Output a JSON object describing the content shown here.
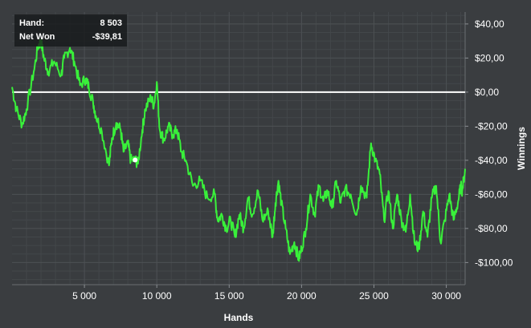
{
  "tooltip": {
    "hand_label": "Hand:",
    "hand_value": "8 503",
    "net_label": "Net Won",
    "net_value": "-$39,81"
  },
  "colors": {
    "background": "#3a3d40",
    "grid": "#4c5053",
    "line": "#39f03a",
    "zero_line": "#ffffff"
  },
  "chart_data": {
    "type": "line",
    "xlabel": "Hands",
    "ylabel": "Winnings",
    "xlim": [
      0,
      31300
    ],
    "ylim": [
      -113,
      47
    ],
    "x_ticks": [
      5000,
      10000,
      15000,
      20000,
      25000,
      30000
    ],
    "x_tick_labels": [
      "5 000",
      "10 000",
      "15 000",
      "20 000",
      "25 000",
      "30 000"
    ],
    "y_ticks": [
      40,
      20,
      0,
      -20,
      -40,
      -60,
      -80,
      -100
    ],
    "y_tick_labels": [
      "$40,00",
      "$20,00",
      "$0,00",
      "-$20,00",
      "-$40,00",
      "-$60,00",
      "-$80,00",
      "-$100,00"
    ],
    "grid": true,
    "zero_line": true,
    "highlight_point": {
      "x": 8503,
      "y": -39.81
    },
    "series": [
      {
        "x": [
          0,
          300,
          700,
          1000,
          1500,
          1800,
          2000,
          2200,
          2500,
          2900,
          3400,
          3600,
          4000,
          4300,
          4700,
          5100,
          5300,
          5600,
          5800,
          6200,
          6700,
          6900,
          7200,
          7500,
          7700,
          8000,
          8200,
          8500,
          8700,
          9000,
          9200,
          9600,
          9800,
          10000,
          10200,
          10500,
          10800,
          11100,
          11400,
          11700,
          12000,
          12500,
          13000,
          13500,
          14000,
          14200,
          14500,
          14800,
          15100,
          15400,
          15700,
          16000,
          16300,
          16600,
          17000,
          17300,
          17700,
          18000,
          18200,
          18400,
          18600,
          18900,
          19200,
          19500,
          19800,
          20000,
          20300,
          20600,
          20900,
          21200,
          21500,
          21800,
          22100,
          22400,
          22700,
          23000,
          23400,
          23800,
          24100,
          24500,
          24800,
          25100,
          25400,
          25700,
          26000,
          26300,
          26600,
          26900,
          27200,
          27500,
          27800,
          28100,
          28400,
          28700,
          29000,
          29300,
          29600,
          29900,
          30200,
          30500,
          30800,
          31000,
          31100,
          31300
        ],
        "y": [
          3,
          -10,
          -19,
          -10,
          12,
          27,
          30,
          20,
          12,
          18,
          10,
          20,
          26,
          18,
          4,
          8,
          3,
          -6,
          -14,
          -23,
          -43,
          -27,
          -18,
          -22,
          -35,
          -30,
          -40,
          -39.81,
          -42,
          -22,
          -10,
          -3,
          -8,
          6,
          -22,
          -28,
          -20,
          -25,
          -22,
          -35,
          -40,
          -55,
          -52,
          -62,
          -60,
          -75,
          -72,
          -80,
          -75,
          -85,
          -72,
          -80,
          -62,
          -72,
          -58,
          -75,
          -70,
          -85,
          -65,
          -52,
          -65,
          -80,
          -95,
          -88,
          -98,
          -92,
          -80,
          -60,
          -72,
          -55,
          -64,
          -58,
          -68,
          -52,
          -65,
          -57,
          -60,
          -72,
          -55,
          -62,
          -30,
          -40,
          -48,
          -75,
          -58,
          -80,
          -60,
          -75,
          -82,
          -60,
          -88,
          -92,
          -70,
          -85,
          -62,
          -55,
          -88,
          -75,
          -60,
          -75,
          -65,
          -55,
          -58,
          -45
        ]
      }
    ]
  }
}
